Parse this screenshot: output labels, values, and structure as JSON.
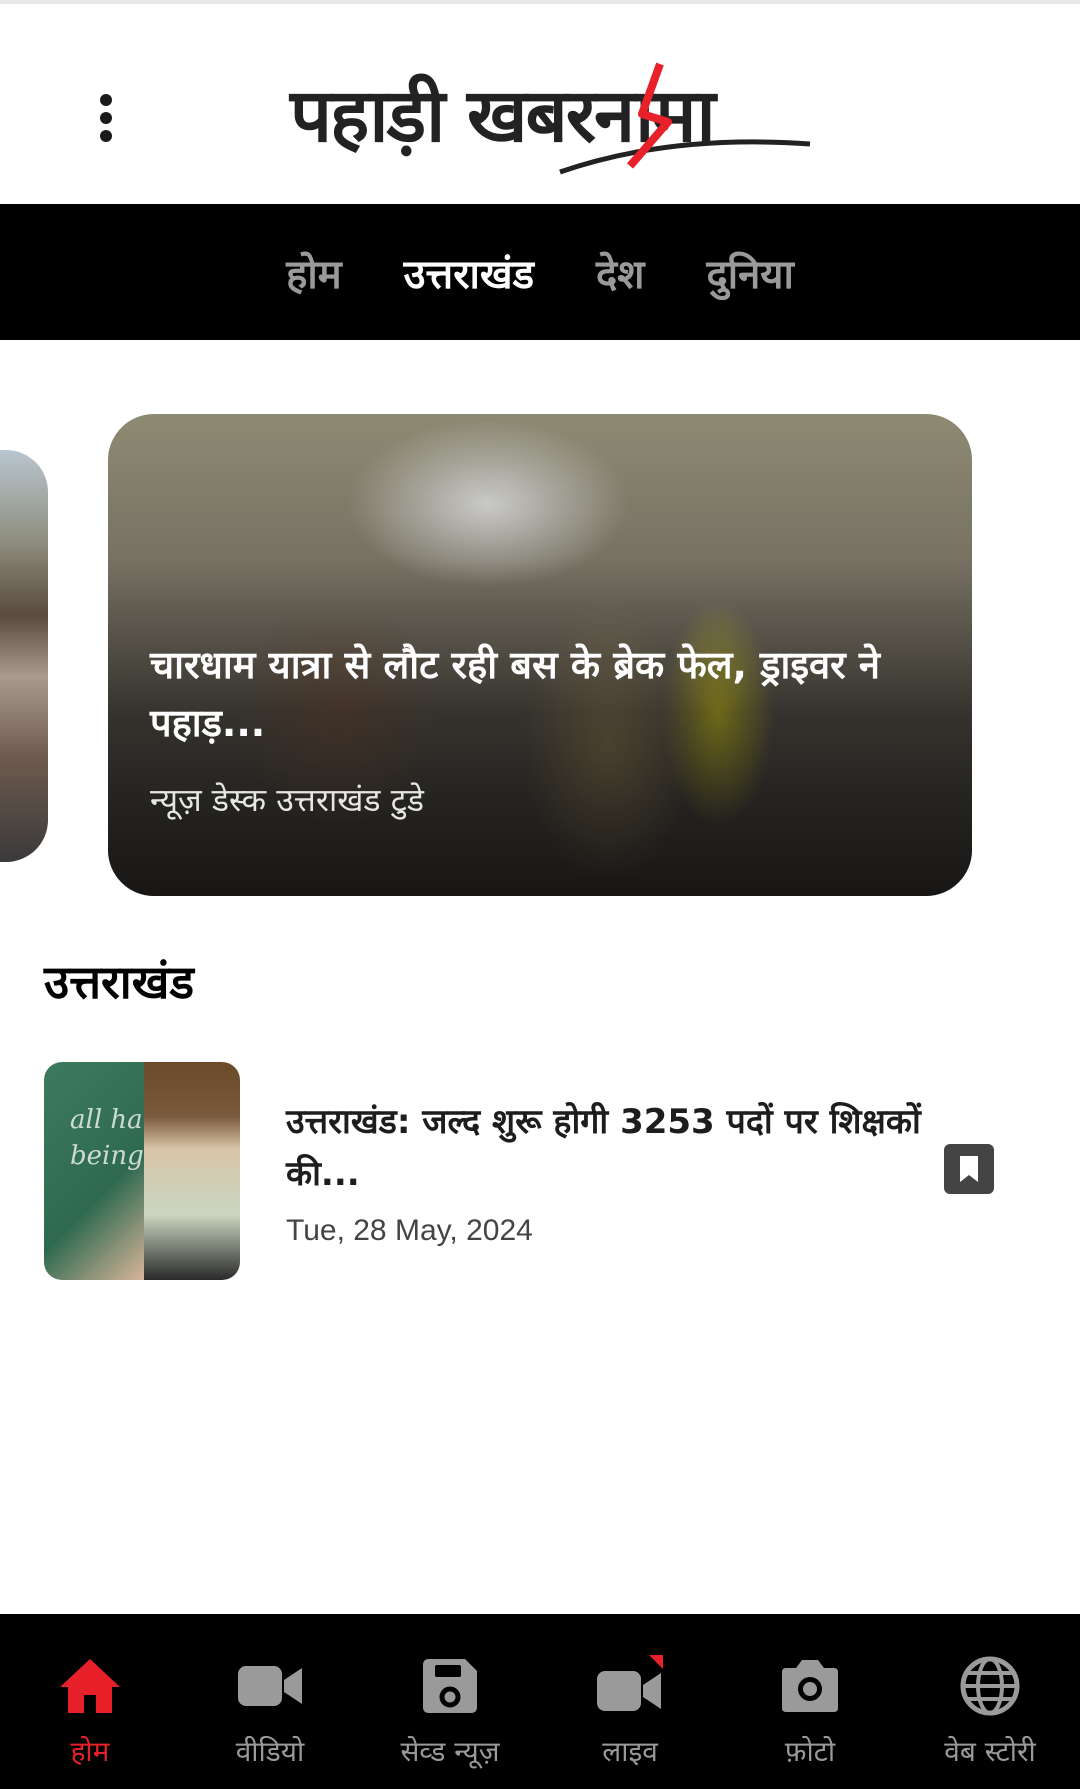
{
  "header": {
    "logo_text": "पहाड़ी खबरनामा"
  },
  "nav": {
    "items": [
      {
        "label": "होम"
      },
      {
        "label": "उत्तराखंड"
      },
      {
        "label": "देश"
      },
      {
        "label": "दुनिया"
      }
    ],
    "active_index": 1
  },
  "featured": {
    "title": "चारधाम यात्रा से लौट रही बस के ब्रेक फेल, ड्राइवर ने पहाड़...",
    "author": "न्यूज़ डेस्क उत्तराखंड टुडे"
  },
  "section": {
    "title": "उत्तराखंड",
    "articles": [
      {
        "title": "उत्तराखंड: जल्द शुरू होगी 3253 पदों पर शिक्षकों की...",
        "date": "Tue, 28 May, 2024",
        "thumb_text": "all ha being"
      }
    ]
  },
  "bottom_nav": {
    "items": [
      {
        "label": "होम",
        "icon": "home-icon"
      },
      {
        "label": "वीडियो",
        "icon": "video-icon"
      },
      {
        "label": "सेव्ड न्यूज़",
        "icon": "save-icon"
      },
      {
        "label": "लाइव",
        "icon": "live-icon"
      },
      {
        "label": "फ़ोटो",
        "icon": "camera-icon"
      },
      {
        "label": "वेब स्टोरी",
        "icon": "globe-icon"
      }
    ],
    "active_index": 0
  },
  "colors": {
    "accent": "#e8202a",
    "nav_bg": "#000000",
    "inactive": "#9a9a9a"
  }
}
